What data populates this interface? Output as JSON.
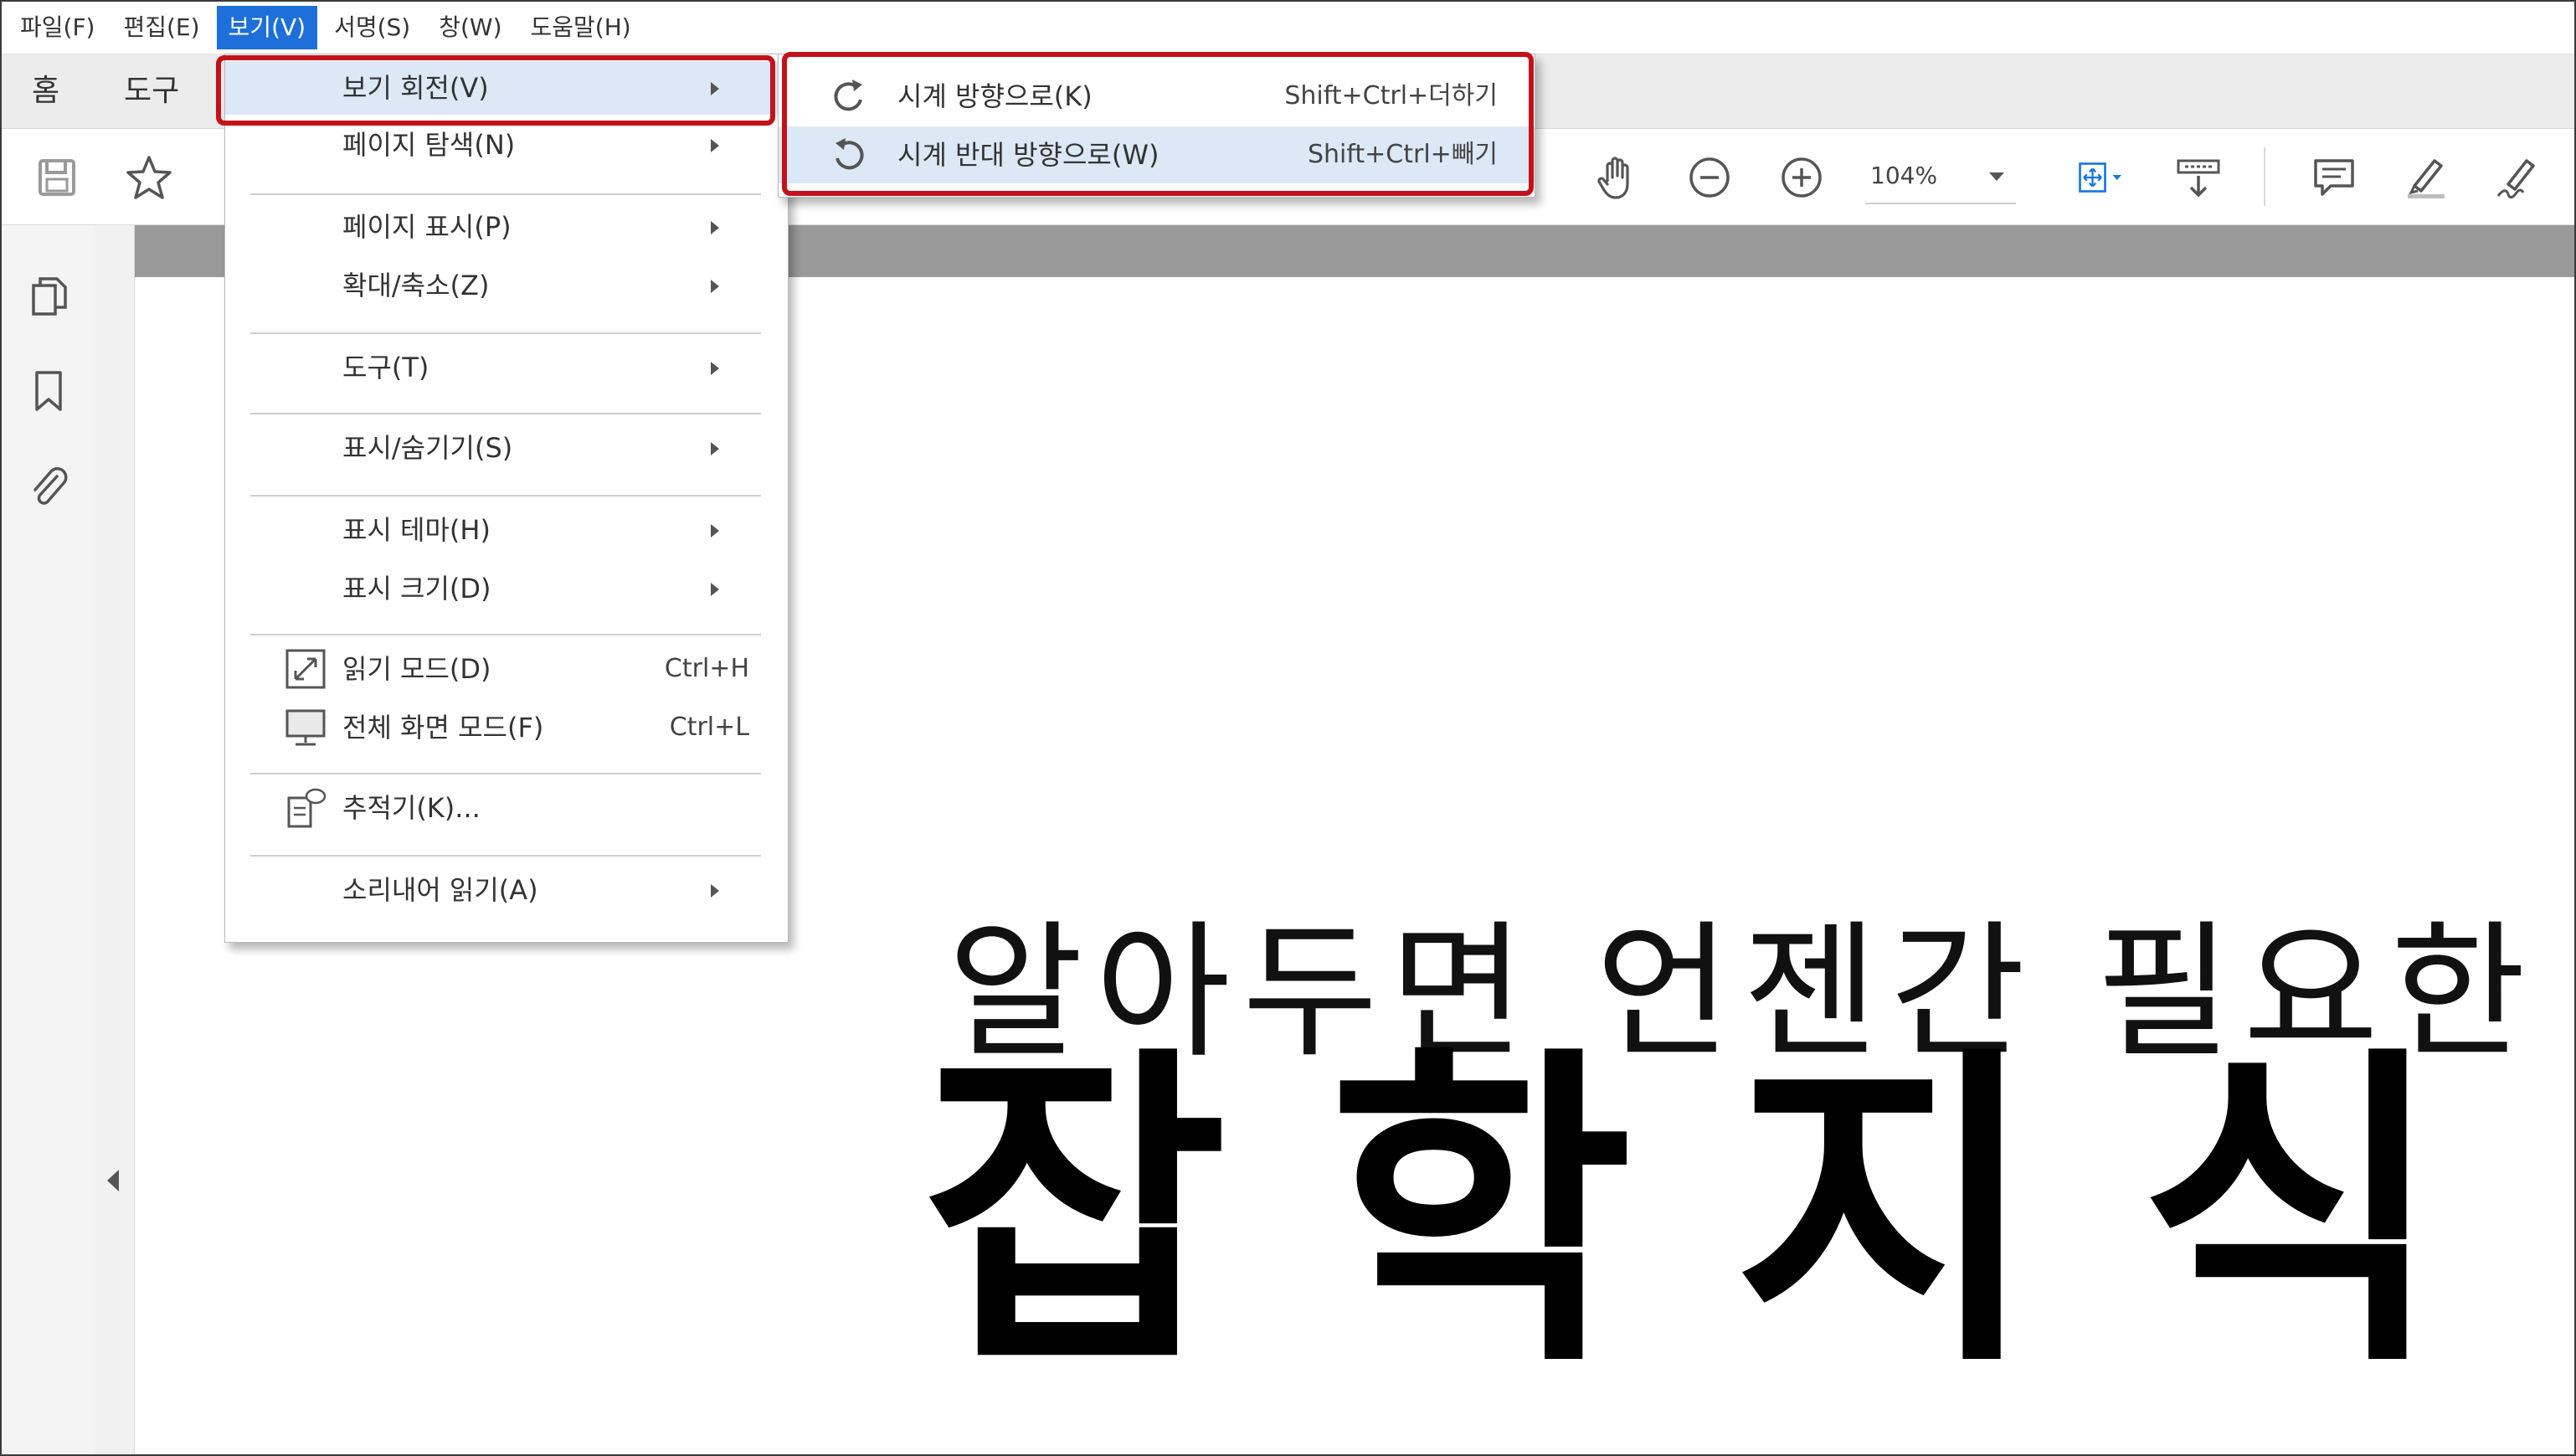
{
  "menubar": {
    "items": [
      "파일(F)",
      "편집(E)",
      "보기(V)",
      "서명(S)",
      "창(W)",
      "도움말(H)"
    ],
    "active_index": 2
  },
  "tabs": {
    "home": "홈",
    "tools": "도구"
  },
  "toolbar": {
    "zoom": "104%",
    "icons": [
      "save-icon",
      "star-icon",
      "hand-icon",
      "zoom-out-icon",
      "zoom-in-icon",
      "fit-page-icon",
      "scroll-mode-icon",
      "comment-icon",
      "highlight-icon",
      "sign-icon"
    ]
  },
  "leftnav": {
    "icons": [
      "pages-icon",
      "bookmark-icon",
      "attachment-icon"
    ]
  },
  "view_menu": {
    "items": [
      {
        "label": "보기 회전(V)",
        "submenu": true
      },
      {
        "label": "페이지 탐색(N)",
        "submenu": true
      },
      {
        "label": "페이지 표시(P)",
        "submenu": true
      },
      {
        "label": "확대/축소(Z)",
        "submenu": true
      },
      {
        "label": "도구(T)",
        "submenu": true
      },
      {
        "label": "표시/숨기기(S)",
        "submenu": true
      },
      {
        "label": "표시 테마(H)",
        "submenu": true
      },
      {
        "label": "표시 크기(D)",
        "submenu": true
      },
      {
        "label": "읽기 모드(D)",
        "shortcut": "Ctrl+H"
      },
      {
        "label": "전체 화면 모드(F)",
        "shortcut": "Ctrl+L"
      },
      {
        "label": "추적기(K)..."
      },
      {
        "label": "소리내어 읽기(A)",
        "submenu": true
      }
    ]
  },
  "rotate_submenu": {
    "items": [
      {
        "label": "시계 방향으로(K)",
        "shortcut": "Shift+Ctrl+더하기"
      },
      {
        "label": "시계 반대 방향으로(W)",
        "shortcut": "Shift+Ctrl+빼기"
      }
    ]
  },
  "document": {
    "subtitle": "알아두면 언젠간 필요한",
    "title": "잡학지식"
  },
  "colors": {
    "menu_active": "#1e6fd9",
    "highlight": "#dce8f6",
    "annotation_red": "#c4121a",
    "accent_blue": "#1473e6"
  }
}
